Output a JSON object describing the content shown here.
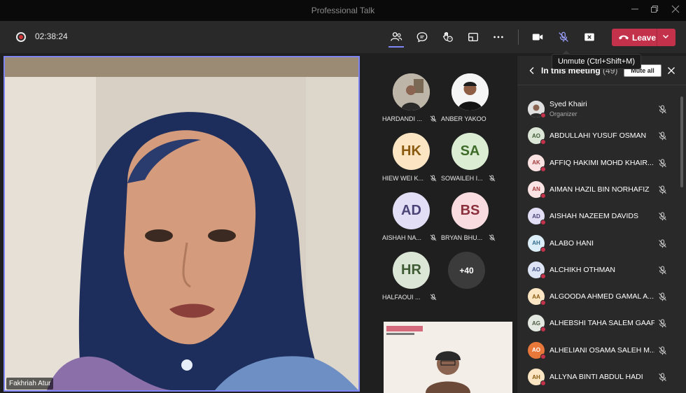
{
  "window": {
    "title": "Professional Talk"
  },
  "toolbar": {
    "timer": "02:38:24",
    "leave_label": "Leave",
    "tooltip": "Unmute (Ctrl+Shift+M)"
  },
  "main_video": {
    "name": "Fakhriah Atur"
  },
  "grid": {
    "tiles": [
      {
        "name": "HARDANDI ...",
        "initials": "",
        "type": "photo"
      },
      {
        "name": "ANBER YAKOO...",
        "initials": "",
        "type": "photo"
      },
      {
        "name": "HIEW WEI K...",
        "initials": "HK",
        "bg": "#fbe5c3",
        "fg": "#8a5a10"
      },
      {
        "name": "SOWAILEH I...",
        "initials": "SA",
        "bg": "#dbeed3",
        "fg": "#3f6b2a"
      },
      {
        "name": "AISHAH NA...",
        "initials": "AD",
        "bg": "#e1def5",
        "fg": "#4b4478"
      },
      {
        "name": "BRYAN BHU...",
        "initials": "BS",
        "bg": "#f9dce0",
        "fg": "#8a2f3c"
      },
      {
        "name": "HALFAOUI ...",
        "initials": "HR",
        "bg": "#dbe6d6",
        "fg": "#3e5b34"
      }
    ],
    "more_count": "+40"
  },
  "panel": {
    "title": "In this meeting",
    "count": "(49)",
    "mute_all_label": "Mute all",
    "participants": [
      {
        "name": "Syed Khairi",
        "role": "Organizer",
        "initials": "",
        "bg": "#d9d9d9",
        "fg": "#333"
      },
      {
        "name": "ABDULLAHI YUSUF OSMAN",
        "initials": "AO",
        "bg": "#dbe6d6",
        "fg": "#3e5b34"
      },
      {
        "name": "AFFIQ HAKIMI MOHD KHAIR...",
        "initials": "AK",
        "bg": "#fbe3e3",
        "fg": "#a23b3b"
      },
      {
        "name": "AIMAN HAZIL BIN NORHAFIZ",
        "initials": "AN",
        "bg": "#fbe3e3",
        "fg": "#a23b3b"
      },
      {
        "name": "AISHAH NAZEEM DAVIDS",
        "initials": "AD",
        "bg": "#e1def5",
        "fg": "#4b4478"
      },
      {
        "name": "ALABO HANI",
        "initials": "AH",
        "bg": "#dceef7",
        "fg": "#2e6a8a"
      },
      {
        "name": "ALCHIKH OTHMAN",
        "initials": "AO",
        "bg": "#dde4f5",
        "fg": "#3d4f82"
      },
      {
        "name": "ALGOODA AHMED GAMAL A...",
        "initials": "AA",
        "bg": "#fbe5c3",
        "fg": "#8a5a10"
      },
      {
        "name": "ALHEBSHI TAHA SALEM GAAF...",
        "initials": "AG",
        "bg": "#e3e8e0",
        "fg": "#4b5c44"
      },
      {
        "name": "ALHELIANI OSAMA SALEH M...",
        "initials": "AO",
        "bg": "#e8773a",
        "fg": "#ffffff"
      },
      {
        "name": "ALLYNA BINTI ABDUL HADI",
        "initials": "AH",
        "bg": "#fbe5c3",
        "fg": "#8a5a10"
      }
    ]
  }
}
